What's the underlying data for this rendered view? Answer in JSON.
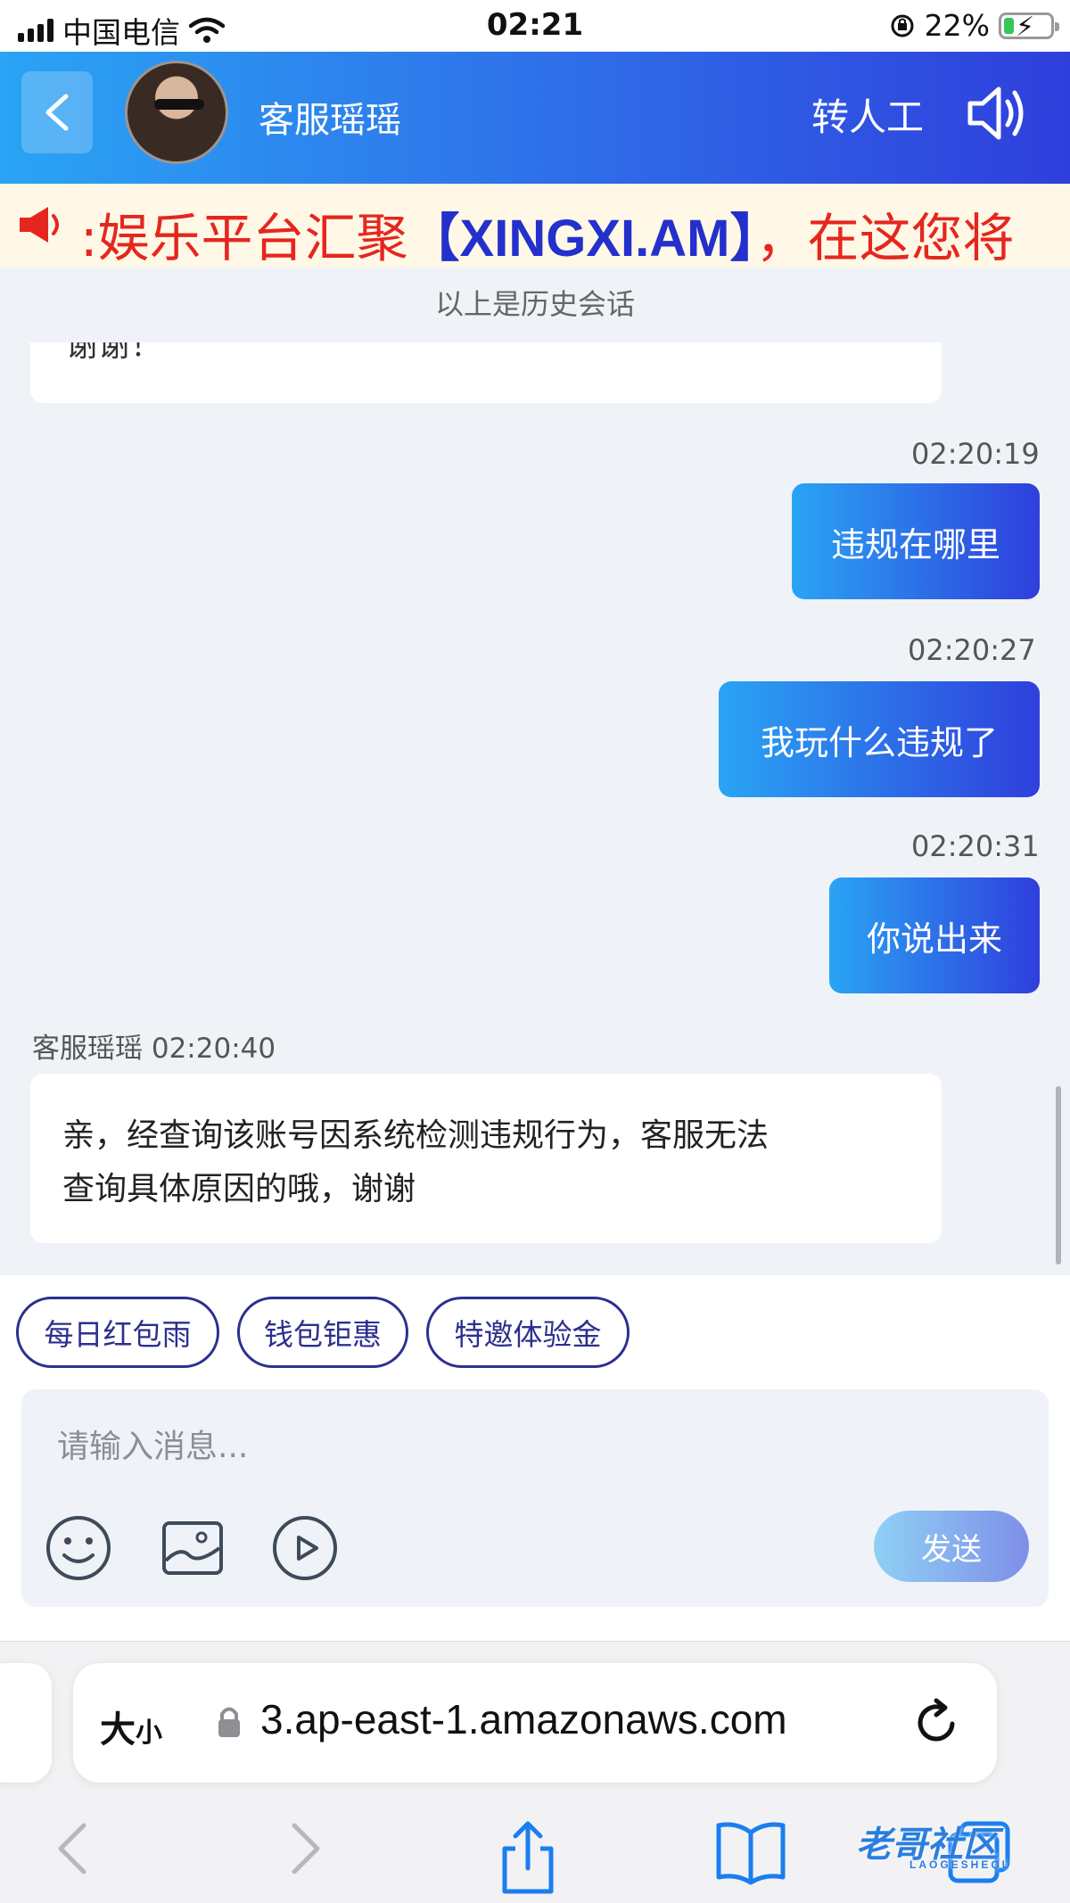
{
  "status_bar": {
    "carrier": "中国电信",
    "time": "02:21",
    "battery_percent": "22%",
    "battery_level": 0.22
  },
  "header": {
    "title": "客服瑶瑶",
    "human_agent_label": "转人工"
  },
  "marquee": {
    "text_before": ":娱乐平台汇聚",
    "highlight": "【XINGXI.AM】",
    "text_after": "，在这您将"
  },
  "chat": {
    "history_note": "以上是历史会话",
    "truncated_text": "谢谢！",
    "messages": [
      {
        "time": "02:20:19",
        "text": "违规在哪里"
      },
      {
        "time": "02:20:27",
        "text": "我玩什么违规了"
      },
      {
        "time": "02:20:31",
        "text": "你说出来"
      }
    ],
    "reply": {
      "sender": "客服瑶瑶",
      "time": "02:20:40",
      "line1": "亲，经查询该账号因系统检测违规行为，客服无法",
      "line2": "查询具体原因的哦，谢谢"
    }
  },
  "quick_replies": [
    "每日红包雨",
    "钱包钜惠",
    "特邀体验金"
  ],
  "composer": {
    "placeholder": "请输入消息...",
    "send_label": "发送"
  },
  "safari": {
    "aa_label": "大",
    "aa_small": "小",
    "url": "3.ap-east-1.amazonaws.com"
  },
  "watermark": {
    "text": "老哥社区",
    "sub": "LAOGESHEQU"
  }
}
